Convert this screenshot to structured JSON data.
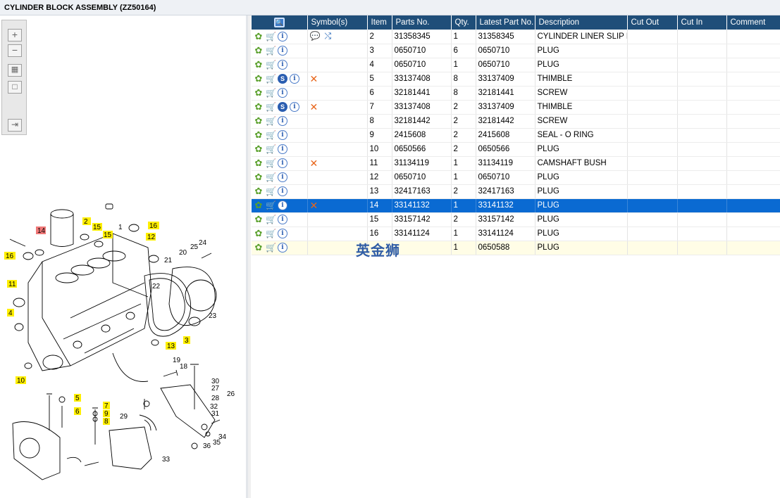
{
  "title": "CYLINDER BLOCK ASSEMBLY (ZZ50164)",
  "toolbar": {
    "zoom_in": "+",
    "zoom_out": "−",
    "fit_all": "▦",
    "fit_page": "□",
    "export": "⇥"
  },
  "table": {
    "headers": [
      "",
      "Symbol(s)",
      "Item",
      "Parts No.",
      "Qty.",
      "Latest Part No.",
      "Description",
      "Cut Out",
      "Cut In",
      "Comment"
    ],
    "rows": [
      {
        "item": "2",
        "part_no": "31358345",
        "qty": "1",
        "latest": "31358345",
        "desc": "CYLINDER LINER SLIP FIT",
        "s": false,
        "sym": "note-link",
        "selected": false
      },
      {
        "item": "3",
        "part_no": "0650710",
        "qty": "6",
        "latest": "0650710",
        "desc": "PLUG",
        "s": false,
        "sym": "",
        "selected": false
      },
      {
        "item": "4",
        "part_no": "0650710",
        "qty": "1",
        "latest": "0650710",
        "desc": "PLUG",
        "s": false,
        "sym": "",
        "selected": false
      },
      {
        "item": "5",
        "part_no": "33137408",
        "qty": "8",
        "latest": "33137409",
        "desc": "THIMBLE",
        "s": true,
        "sym": "x",
        "selected": false
      },
      {
        "item": "6",
        "part_no": "32181441",
        "qty": "8",
        "latest": "32181441",
        "desc": "SCREW",
        "s": false,
        "sym": "",
        "selected": false
      },
      {
        "item": "7",
        "part_no": "33137408",
        "qty": "2",
        "latest": "33137409",
        "desc": "THIMBLE",
        "s": true,
        "sym": "x",
        "selected": false
      },
      {
        "item": "8",
        "part_no": "32181442",
        "qty": "2",
        "latest": "32181442",
        "desc": "SCREW",
        "s": false,
        "sym": "",
        "selected": false
      },
      {
        "item": "9",
        "part_no": "2415608",
        "qty": "2",
        "latest": "2415608",
        "desc": "SEAL - O RING",
        "s": false,
        "sym": "",
        "selected": false
      },
      {
        "item": "10",
        "part_no": "0650566",
        "qty": "2",
        "latest": "0650566",
        "desc": "PLUG",
        "s": false,
        "sym": "",
        "selected": false
      },
      {
        "item": "11",
        "part_no": "31134119",
        "qty": "1",
        "latest": "31134119",
        "desc": "CAMSHAFT BUSH",
        "s": false,
        "sym": "x",
        "selected": false
      },
      {
        "item": "12",
        "part_no": "0650710",
        "qty": "1",
        "latest": "0650710",
        "desc": "PLUG",
        "s": false,
        "sym": "",
        "selected": false
      },
      {
        "item": "13",
        "part_no": "32417163",
        "qty": "2",
        "latest": "32417163",
        "desc": "PLUG",
        "s": false,
        "sym": "",
        "selected": false
      },
      {
        "item": "14",
        "part_no": "33141132",
        "qty": "1",
        "latest": "33141132",
        "desc": "PLUG",
        "s": false,
        "sym": "x",
        "selected": true
      },
      {
        "item": "15",
        "part_no": "33157142",
        "qty": "2",
        "latest": "33157142",
        "desc": "PLUG",
        "s": false,
        "sym": "",
        "selected": false
      },
      {
        "item": "16",
        "part_no": "33141124",
        "qty": "1",
        "latest": "33141124",
        "desc": "PLUG",
        "s": false,
        "sym": "",
        "selected": false
      },
      {
        "item": "",
        "part_no": "",
        "qty": "1",
        "latest": "0650588",
        "desc": "PLUG",
        "s": false,
        "sym": "",
        "selected": false,
        "last": true
      }
    ]
  },
  "watermark": "英金狮",
  "diagram": {
    "callouts_yellow": [
      "2",
      "15",
      "15",
      "16",
      "12",
      "16",
      "11",
      "4",
      "10",
      "3",
      "13",
      "5",
      "6",
      "7",
      "9",
      "8"
    ],
    "callouts_red": [
      "14"
    ],
    "labels": [
      "1",
      "21",
      "20",
      "25",
      "24",
      "22",
      "23",
      "19",
      "18",
      "30",
      "27",
      "26",
      "28",
      "32",
      "31",
      "34",
      "35",
      "36",
      "29",
      "33"
    ]
  }
}
